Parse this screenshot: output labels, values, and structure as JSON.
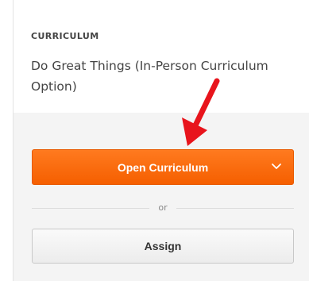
{
  "curriculum": {
    "eyebrow": "CURRICULUM",
    "title": "Do Great Things (In-Person Curriculum Option)"
  },
  "actions": {
    "open_label": "Open Curriculum",
    "divider_text": "or",
    "assign_label": "Assign"
  },
  "colors": {
    "primary": "#f96a0c",
    "annotation_arrow": "#e8141c"
  },
  "icons": {
    "dropdown": "chevron-down-icon",
    "annotation": "red-arrow-icon"
  }
}
